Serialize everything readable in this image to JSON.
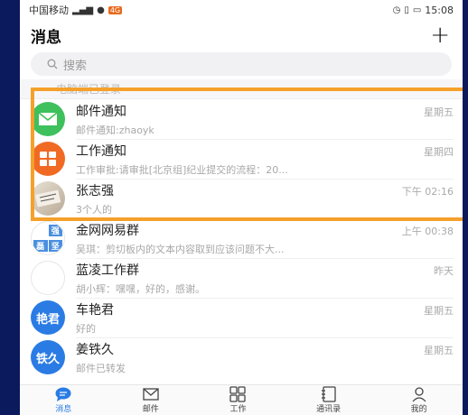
{
  "status_bar": {
    "carrier": "中国移动",
    "badge": "4G",
    "time": "15:08"
  },
  "header": {
    "title": "消息",
    "add_label": "+"
  },
  "search": {
    "placeholder": "搜索"
  },
  "notice": {
    "text": "电脑端已登录"
  },
  "conversations": [
    {
      "name": "邮件通知",
      "time": "星期五",
      "preview": "邮件通知:zhaoyk",
      "avatar_color": "#3ec05c",
      "avatar_icon": "mail-icon"
    },
    {
      "name": "工作通知",
      "time": "星期四",
      "preview": "工作审批:请审批[北京组]纪业提交的流程：20...",
      "avatar_color": "#f06a24",
      "avatar_icon": "grid-icon"
    },
    {
      "name": "张志强",
      "time": "下午 02:16",
      "preview": "3个人的",
      "avatar_color": "#d8d0c4",
      "avatar_icon": "photo-avatar"
    },
    {
      "name": "金网网易群",
      "time": "上午 00:38",
      "preview": "吴琪：剪切板内的文本内容取到应该问题不大...",
      "avatar_color": "#4a8fe0",
      "avatar_icon": "group-avatar",
      "avatar_text": "强磊"
    },
    {
      "name": "蓝凌工作群",
      "time": "昨天",
      "preview": "胡小辉：嘿嘿，好的，感谢。",
      "avatar_color": "#6a7d8f",
      "avatar_icon": "group-photo-avatar"
    },
    {
      "name": "车艳君",
      "time": "星期五",
      "preview": "好的",
      "avatar_color": "#2a7be4",
      "avatar_text": "艳君"
    },
    {
      "name": "姜铁久",
      "time": "星期五",
      "preview": "邮件已转发",
      "avatar_color": "#2a7be4",
      "avatar_text": "铁久"
    }
  ],
  "tabs": [
    {
      "label": "消息",
      "icon": "chat-icon",
      "active": true
    },
    {
      "label": "邮件",
      "icon": "mail-icon",
      "active": false
    },
    {
      "label": "工作",
      "icon": "grid-icon",
      "active": false
    },
    {
      "label": "通讯录",
      "icon": "contacts-icon",
      "active": false
    },
    {
      "label": "我的",
      "icon": "person-icon",
      "active": false
    }
  ],
  "colors": {
    "accent": "#2a7be4",
    "highlight": "#f5a02a",
    "background": "#0a1a5c"
  }
}
